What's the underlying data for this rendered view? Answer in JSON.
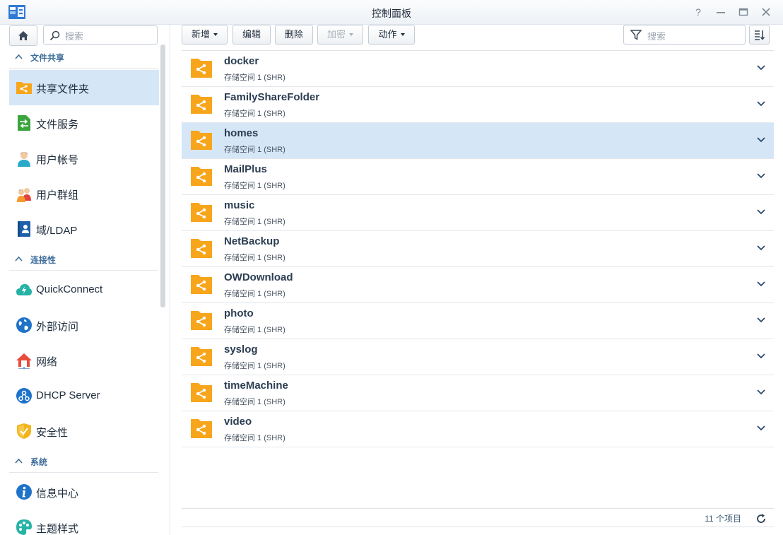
{
  "window": {
    "title": "控制面板"
  },
  "sidebar": {
    "search_placeholder": "搜索",
    "sections": [
      {
        "label": "文件共享",
        "items": [
          {
            "label": "共享文件夹",
            "icon": "shared-folder-icon",
            "active": true
          },
          {
            "label": "文件服务",
            "icon": "file-services-icon"
          },
          {
            "label": "用户帐号",
            "icon": "user-icon"
          },
          {
            "label": "用户群组",
            "icon": "group-icon"
          },
          {
            "label": "域/LDAP",
            "icon": "domain-ldap-icon"
          }
        ]
      },
      {
        "label": "连接性",
        "items": [
          {
            "label": "QuickConnect",
            "icon": "quickconnect-icon"
          },
          {
            "label": "外部访问",
            "icon": "external-access-icon"
          },
          {
            "label": "网络",
            "icon": "network-icon"
          },
          {
            "label": "DHCP Server",
            "icon": "dhcp-server-icon"
          },
          {
            "label": "安全性",
            "icon": "security-icon"
          }
        ]
      },
      {
        "label": "系统",
        "items": [
          {
            "label": "信息中心",
            "icon": "info-center-icon"
          },
          {
            "label": "主题样式",
            "icon": "theme-icon"
          }
        ]
      }
    ]
  },
  "toolbar": {
    "create_label": "新增",
    "edit_label": "编辑",
    "delete_label": "删除",
    "encrypt_label": "加密",
    "action_label": "动作",
    "search_placeholder": "搜索"
  },
  "folders": [
    {
      "name": "docker",
      "location": "存储空间 1 (SHR)"
    },
    {
      "name": "FamilyShareFolder",
      "location": "存储空间 1 (SHR)"
    },
    {
      "name": "homes",
      "location": "存储空间 1 (SHR)",
      "selected": true
    },
    {
      "name": "MailPlus",
      "location": "存储空间 1 (SHR)"
    },
    {
      "name": "music",
      "location": "存储空间 1 (SHR)"
    },
    {
      "name": "NetBackup",
      "location": "存储空间 1 (SHR)"
    },
    {
      "name": "OWDownload",
      "location": "存储空间 1 (SHR)"
    },
    {
      "name": "photo",
      "location": "存储空间 1 (SHR)"
    },
    {
      "name": "syslog",
      "location": "存储空间 1 (SHR)"
    },
    {
      "name": "timeMachine",
      "location": "存储空间 1 (SHR)"
    },
    {
      "name": "video",
      "location": "存储空间 1 (SHR)"
    }
  ],
  "footer": {
    "count_label": "11 个项目"
  },
  "colors": {
    "accent": "#3f6e9c",
    "selection": "#d5e6f7",
    "folder": "#f7a51b"
  }
}
